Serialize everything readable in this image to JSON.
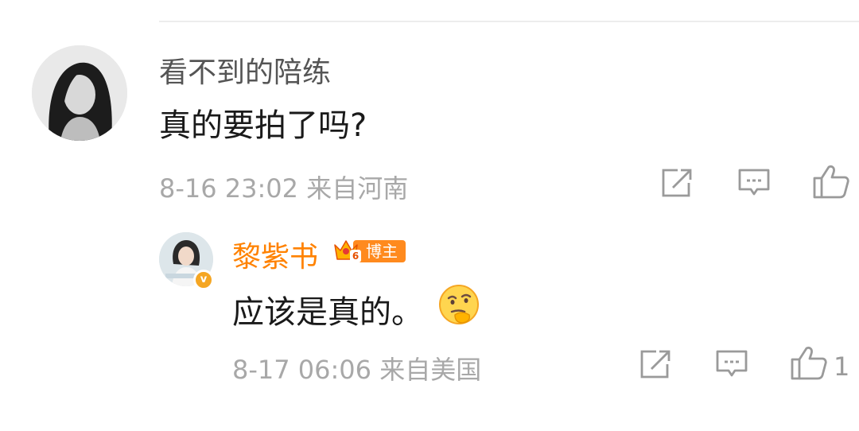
{
  "comment": {
    "username": "看不到的陪练",
    "text": "真的要拍了吗?",
    "timestamp": "8-16 23:02",
    "location": "来自河南",
    "avatar_icon": "avatar-photo-icon"
  },
  "reply": {
    "username": "黎紫书",
    "badge_level": "6",
    "badge_label": "博主",
    "text": "应该是真的。",
    "emoji": "thinking-emoji",
    "timestamp": "8-17 06:06",
    "location": "来自美国",
    "like_count": "1",
    "verified_mark": "v"
  },
  "colors": {
    "username": "#555555",
    "blogger_name": "#ff8200",
    "meta": "#a8a8a8",
    "text": "#1a1a1a",
    "verified": "#f5a623"
  }
}
